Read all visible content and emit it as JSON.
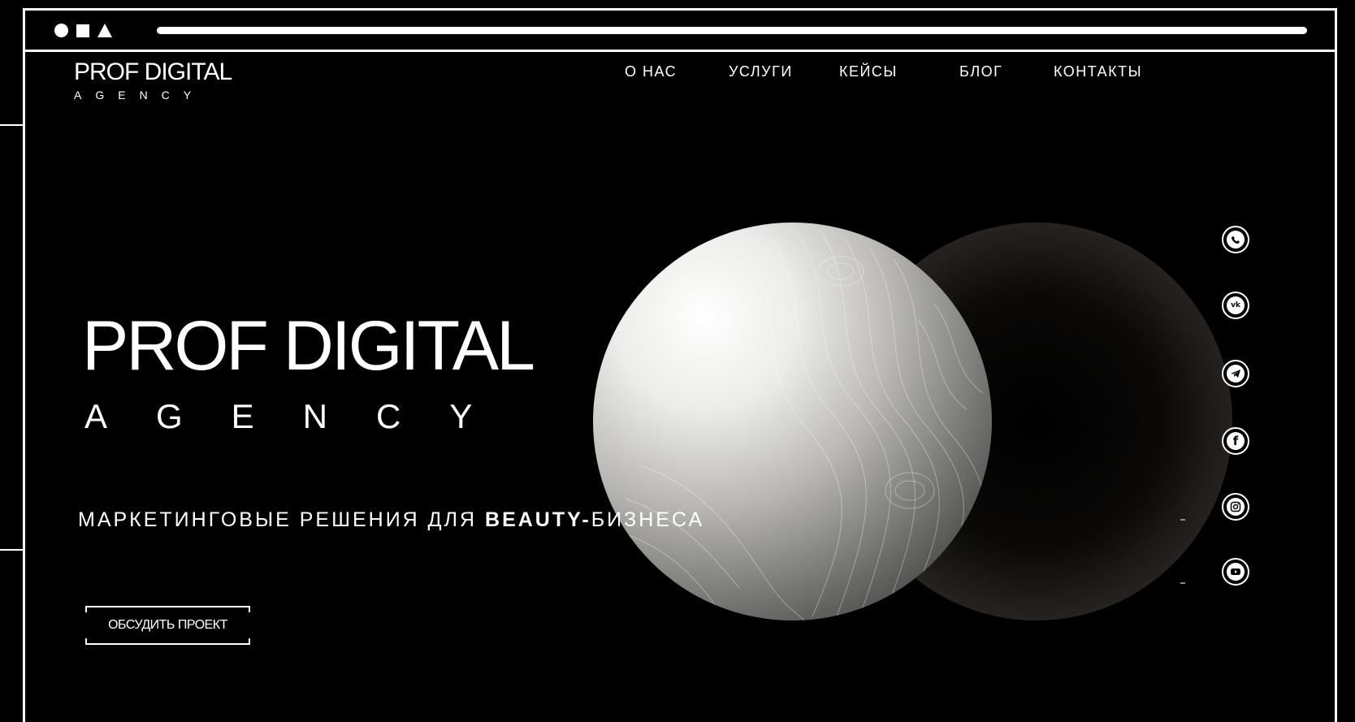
{
  "logo": {
    "title": "PROF DIGITAL",
    "subtitle": "AGENCY"
  },
  "nav": {
    "items": [
      {
        "label": "О НАС"
      },
      {
        "label": "УСЛУГИ"
      },
      {
        "label": "КЕЙСЫ"
      },
      {
        "label": "БЛОГ"
      },
      {
        "label": "КОНТАКТЫ"
      }
    ]
  },
  "hero": {
    "title": "PROF DIGITAL",
    "subtitle": "AGENCY",
    "tagline_part1": "МАРКЕТИНГОВЫЕ РЕШЕНИЯ ДЛЯ ",
    "tagline_bold": "BEAUTY-",
    "tagline_part2": "БИЗНЕСА",
    "cta_label": "ОБСУДИТЬ ПРОЕКТ"
  },
  "social": {
    "icons": [
      "whatsapp-icon",
      "vk-icon",
      "telegram-icon",
      "facebook-icon",
      "instagram-icon",
      "youtube-icon"
    ]
  },
  "colors": {
    "background": "#000000",
    "foreground": "#ffffff"
  }
}
